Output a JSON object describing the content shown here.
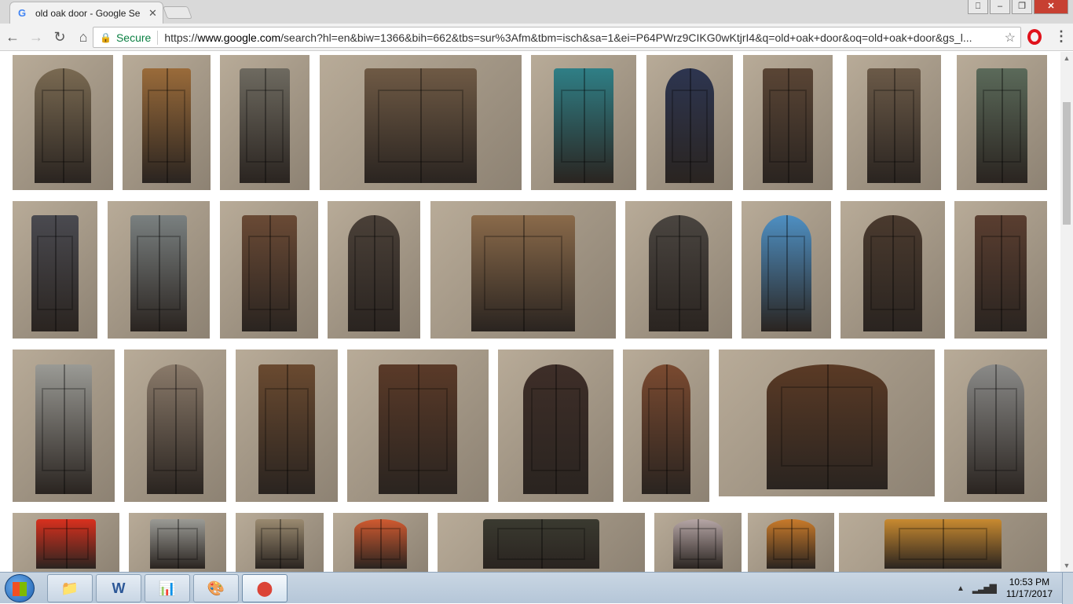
{
  "browser": {
    "tab_title": "old oak door - Google Se",
    "tab_favicon": "G",
    "tab_close": "✕",
    "window_controls": [
      "⎕",
      "–",
      "❐",
      "✕"
    ],
    "nav": {
      "back": "←",
      "forward": "→",
      "reload": "↻",
      "home": "⌂"
    },
    "secure_label": "Secure",
    "url_scheme": "https://",
    "url_host": "www.google.com",
    "url_path": "/search?hl=en&biw=1366&bih=662&tbs=sur%3Afm&tbm=isch&sa=1&ei=P64PWrz9CIKG0wKtjrI4&q=old+oak+door&oq=old+oak+door&gs_l...",
    "star": "☆",
    "menu": "⋮"
  },
  "results": {
    "query": "old oak door",
    "colors": [
      "#7a6a52",
      "#9a6b3a",
      "#6e6a60",
      "#6f5a45",
      "#2f7f86",
      "#2d3550",
      "#5a4535",
      "#6b5a48",
      "#5b6a5a",
      "#4a4a50",
      "#7a8080",
      "#6a4a35",
      "#4a4038",
      "#8a6a4a",
      "#4a4540",
      "#4e8fc2",
      "#4a3a2e",
      "#5a3e30",
      "#9a9a95",
      "#8a7a6a",
      "#6a4a30",
      "#5a3a28",
      "#3e2e28",
      "#7a4a30",
      "#5a3a25",
      "#8a8a88",
      "#d8301e",
      "#9a9a95",
      "#9a8a70",
      "#d05a30",
      "#3a3a30",
      "#b5a5a5",
      "#c87a2a",
      "#c88a30",
      "#4a3a2e"
    ]
  },
  "scrollbar": {
    "up": "▲",
    "down": "▼"
  },
  "taskbar": {
    "apps": [
      "📁",
      "W",
      "📊",
      "🎨",
      "⬤"
    ],
    "time": "10:53 PM",
    "date": "11/17/2017",
    "tray_arrow": "▲",
    "signal": "▂▃▅▇"
  }
}
